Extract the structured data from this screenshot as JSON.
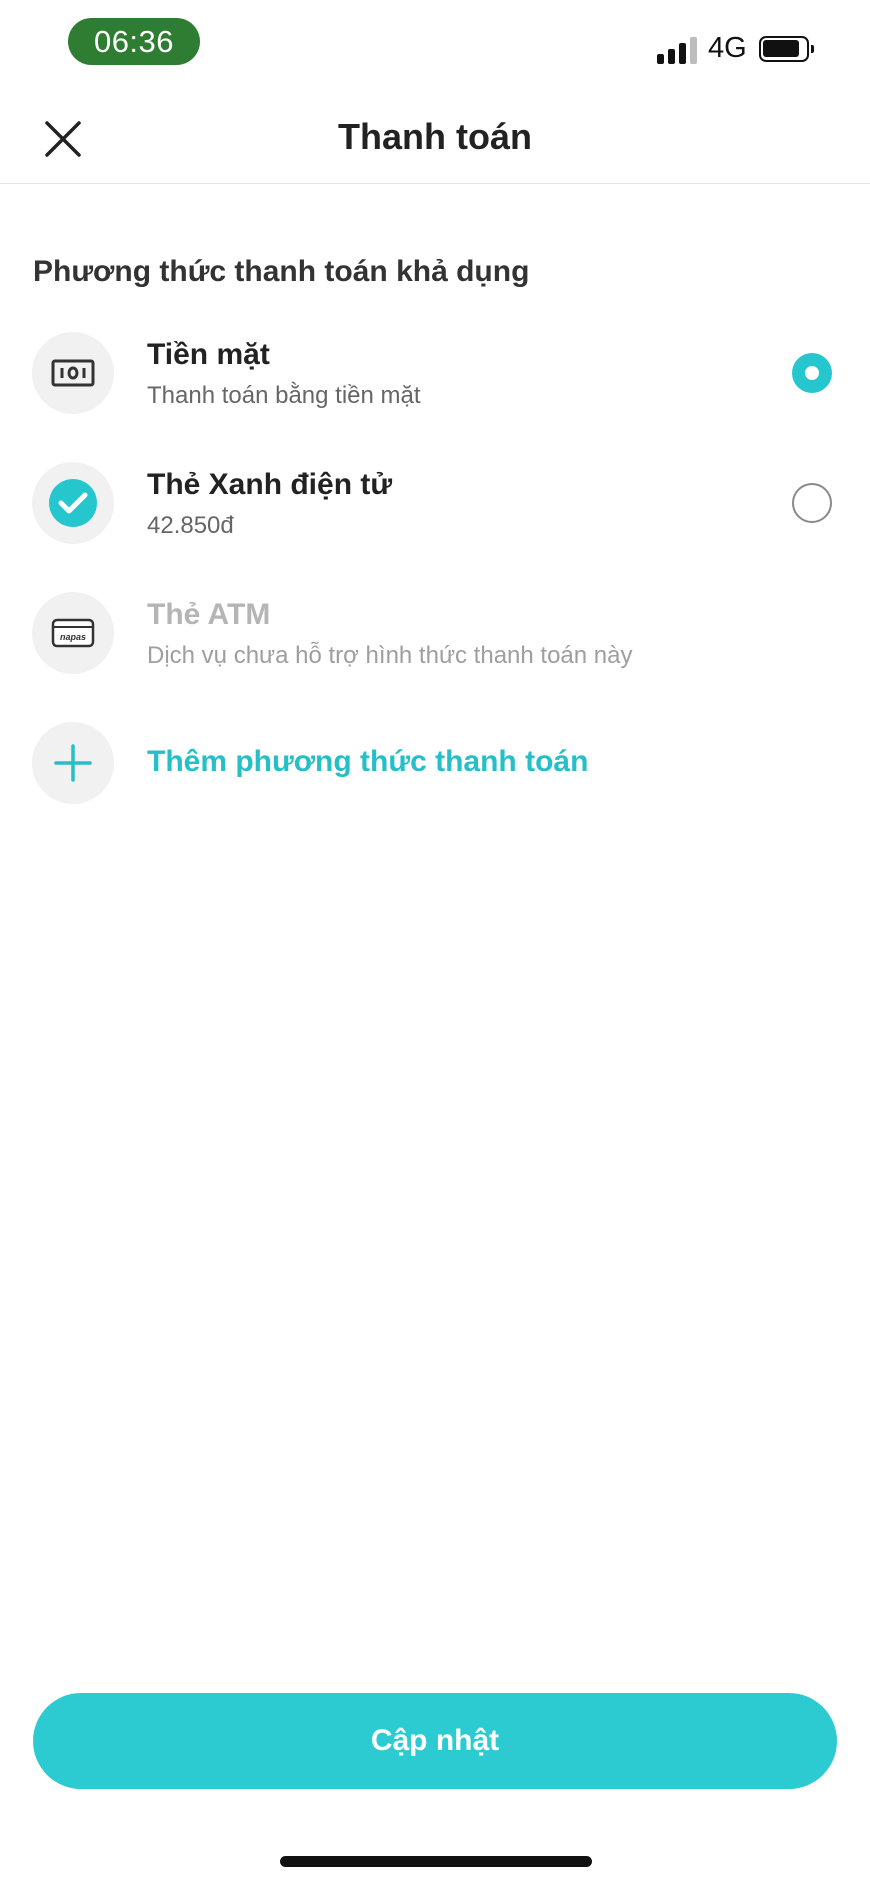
{
  "status_bar": {
    "time": "06:36",
    "network": "4G",
    "pill_color": "#2e7d32"
  },
  "header": {
    "title": "Thanh toán",
    "close_icon": "close-icon"
  },
  "section": {
    "title": "Phương thức thanh toán khả dụng"
  },
  "methods": [
    {
      "title": "Tiền mặt",
      "subtitle": "Thanh toán bằng tiền mặt",
      "icon": "cash-icon",
      "selected": true,
      "enabled": true
    },
    {
      "title": "Thẻ Xanh điện tử",
      "subtitle": "42.850đ",
      "icon": "green-card-icon",
      "selected": false,
      "enabled": true
    },
    {
      "title": "Thẻ ATM",
      "subtitle": "Dịch vụ chưa hỗ trợ hình thức thanh toán này",
      "icon": "napas-card-icon",
      "icon_text": "napas",
      "selected": false,
      "enabled": false
    }
  ],
  "add_method": {
    "label": "Thêm phương thức thanh toán",
    "icon": "plus-icon"
  },
  "footer": {
    "update_label": "Cập nhật"
  },
  "colors": {
    "accent": "#2ccbd2",
    "accent_text": "#26bfc8",
    "disabled_text": "#b5b5b5"
  }
}
